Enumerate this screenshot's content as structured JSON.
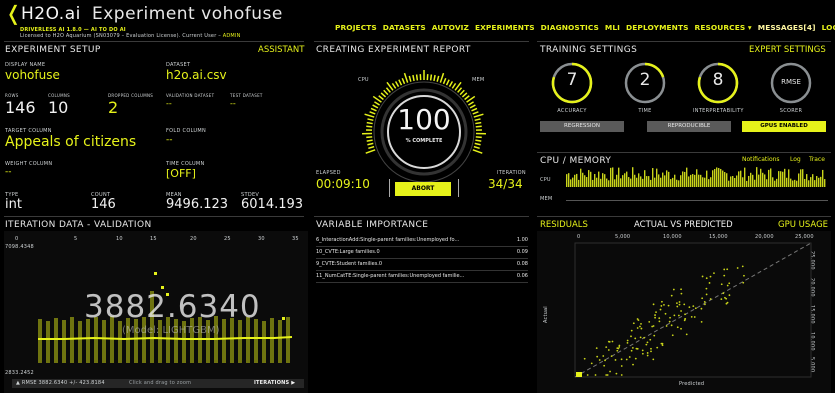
{
  "header": {
    "back_icon": "chevron-left-icon",
    "brand": "H2O.ai",
    "page_title": "Experiment vohofuse",
    "subtitle": "DRIVERLESS AI 1.8.0 — AI TO DO AI",
    "license": "Licensed to H2O Aquarium (SN03079 – Evaluation License). Current User –",
    "user": "ADMIN",
    "nav": [
      "PROJECTS",
      "DATASETS",
      "AUTOVIZ",
      "EXPERIMENTS",
      "DIAGNOSTICS",
      "MLI",
      "DEPLOYMENTS",
      "RESOURCES ▾",
      "MESSAGES[4]",
      "LOGOUT"
    ]
  },
  "setup": {
    "title": "EXPERIMENT SETUP",
    "assistant": "ASSISTANT",
    "display_name_label": "DISPLAY NAME",
    "display_name": "vohofuse",
    "dataset_label": "DATASET",
    "dataset": "h2o.ai.csv",
    "rows_label": "ROWS",
    "rows": "146",
    "columns_label": "COLUMNS",
    "columns": "10",
    "dropped_label": "DROPPED COLUMNS",
    "dropped": "2",
    "validation_label": "VALIDATION DATASET",
    "validation": "--",
    "test_label": "TEST DATASET",
    "test": "--",
    "target_label": "TARGET COLUMN",
    "target": "Appeals of citizens",
    "fold_label": "FOLD COLUMN",
    "fold": "--",
    "weight_label": "WEIGHT COLUMN",
    "weight": "--",
    "time_label": "TIME COLUMN",
    "time": "[OFF]",
    "type_label": "TYPE",
    "type": "int",
    "count_label": "COUNT",
    "count": "146",
    "mean_label": "MEAN",
    "mean": "9496.123",
    "stdev_label": "STDEV",
    "stdev": "6014.193"
  },
  "iteration": {
    "title": "ITERATION DATA - VALIDATION",
    "x_ticks": [
      "0",
      "5",
      "10",
      "15",
      "20",
      "25",
      "30",
      "35"
    ],
    "y_max": "7098.4348",
    "y_min": "2833.2452",
    "big_score": "3882.6340",
    "model": "(Model: LIGHTGBM)",
    "rmse": "▲ RMSE 3882.6340 +/- 423.8184",
    "hint": "Click and drag to zoom",
    "iterations_btn": "ITERATIONS ▶"
  },
  "report": {
    "title": "CREATING EXPERIMENT REPORT",
    "cpu": "CPU",
    "mem": "MEM",
    "percent": "100",
    "percent_label": "% COMPLETE",
    "elapsed_label": "ELAPSED",
    "elapsed": "00:09:10",
    "iteration_label": "ITERATION",
    "iteration": "34/34",
    "abort": "ABORT"
  },
  "varimp": {
    "title": "VARIABLE IMPORTANCE",
    "rows": [
      {
        "name": "6_InteractionAdd:Single-parent families:Unemployed fo...",
        "value": "1.00"
      },
      {
        "name": "10_CVTE:Large families.0",
        "value": "0.09"
      },
      {
        "name": "9_CVTE:Student families.0",
        "value": "0.08"
      },
      {
        "name": "11_NumCatTE:Single-parent families:Unemployed familie...",
        "value": "0.06"
      }
    ]
  },
  "training": {
    "title": "TRAINING SETTINGS",
    "expert": "EXPERT SETTINGS",
    "dials": [
      {
        "value": "7",
        "label": "ACCURACY",
        "level": 0.7
      },
      {
        "value": "2",
        "label": "TIME",
        "level": 0.2
      },
      {
        "value": "8",
        "label": "INTERPRETABILITY",
        "level": 0.8
      },
      {
        "value": "RMSE",
        "label": "SCORER",
        "level": 0
      }
    ],
    "buttons": [
      "REGRESSION",
      "REPRODUCIBLE",
      "GPUS ENABLED"
    ]
  },
  "cpumem": {
    "title": "CPU / MEMORY",
    "links": [
      "Notifications",
      "Log",
      "Trace"
    ],
    "cpu": "CPU",
    "mem": "MEM"
  },
  "bottom_tabs": {
    "residuals": "RESIDUALS",
    "avp": "ACTUAL VS PREDICTED",
    "gpu": "GPU USAGE"
  },
  "scatter": {
    "x_ticks": [
      "0",
      "5,000",
      "10,000",
      "15,000",
      "20,000",
      "25,000"
    ],
    "y_ticks": [
      "25,000",
      "20,000",
      "15,000",
      "10,000",
      "5,000"
    ],
    "xlabel": "Predicted",
    "ylabel": "Actual"
  },
  "colors": {
    "accent": "#e6f21a",
    "bg": "#000000",
    "panel": "#0a0a0a"
  }
}
